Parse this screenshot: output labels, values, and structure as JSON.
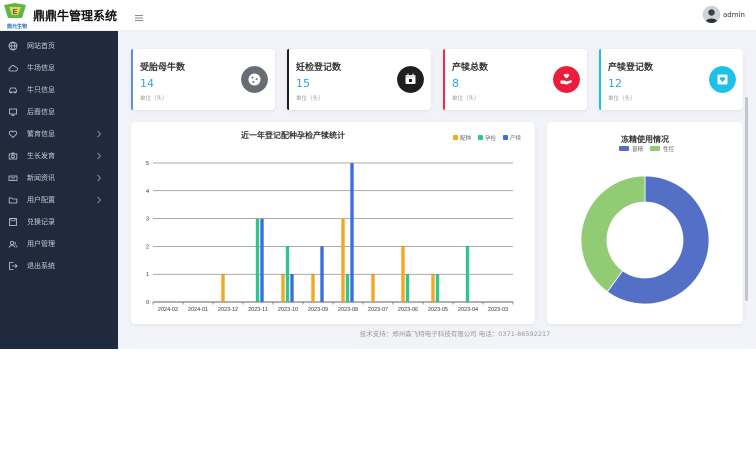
{
  "header": {
    "app_title": "鼎鼎牛管理系统",
    "logo_text": "鼎元生物",
    "username": "admin"
  },
  "sidebar": {
    "items": [
      {
        "label": "网站首页",
        "icon": "globe-icon",
        "caret": false
      },
      {
        "label": "牛场信息",
        "icon": "cloud-icon",
        "caret": false
      },
      {
        "label": "牛只信息",
        "icon": "car-icon",
        "caret": false
      },
      {
        "label": "后裔信息",
        "icon": "monitor-icon",
        "caret": false
      },
      {
        "label": "繁育信息",
        "icon": "heart-icon",
        "caret": true
      },
      {
        "label": "生长发育",
        "icon": "camera-icon",
        "caret": true
      },
      {
        "label": "新闻资讯",
        "icon": "keyboard-icon",
        "caret": true
      },
      {
        "label": "用户配置",
        "icon": "folder-icon",
        "caret": true
      },
      {
        "label": "兑换记录",
        "icon": "save-icon",
        "caret": false
      },
      {
        "label": "用户管理",
        "icon": "users-icon",
        "caret": false
      },
      {
        "label": "退出系统",
        "icon": "logout-icon",
        "caret": false
      }
    ]
  },
  "cards": [
    {
      "title": "受胎母牛数",
      "value": "14",
      "unit": "单位（头）",
      "accent": "#5b8fd6",
      "icon": "cookie-icon",
      "icon_bg": "#666d74"
    },
    {
      "title": "妊检登记数",
      "value": "15",
      "unit": "单位（头）",
      "accent": "#1f1f1f",
      "icon": "calendar-icon",
      "icon_bg": "#1f1f1f"
    },
    {
      "title": "产犊总数",
      "value": "8",
      "unit": "单位（头）",
      "accent": "#e8304a",
      "icon": "hand-heart-icon",
      "icon_bg": "#ec1c3d"
    },
    {
      "title": "产犊登记数",
      "value": "12",
      "unit": "单位（头）",
      "accent": "#1ec1e6",
      "icon": "heart-box-icon",
      "icon_bg": "#1ec1e6"
    }
  ],
  "chart_data": [
    {
      "type": "bar",
      "title": "近一年登记配种孕检产犊统计",
      "categories": [
        "2024-02",
        "2024-01",
        "2023-12",
        "2023-11",
        "2023-10",
        "2023-09",
        "2023-08",
        "2023-07",
        "2023-06",
        "2023-05",
        "2023-04",
        "2023-03"
      ],
      "series": [
        {
          "name": "配种",
          "color": "#f5a623",
          "values": [
            0,
            0,
            1,
            0,
            1,
            1,
            3,
            1,
            2,
            1,
            0,
            0
          ]
        },
        {
          "name": "孕检",
          "color": "#2fc58f",
          "values": [
            0,
            0,
            0,
            3,
            2,
            0,
            1,
            0,
            1,
            1,
            2,
            0
          ]
        },
        {
          "name": "产犊",
          "color": "#3b6ee6",
          "values": [
            0,
            0,
            0,
            3,
            1,
            2,
            5,
            0,
            0,
            0,
            0,
            0
          ]
        }
      ],
      "ylim": [
        0,
        5
      ],
      "yticks": [
        "0",
        "1",
        "2",
        "3",
        "4",
        "5"
      ],
      "grid": true,
      "legend": "top-right"
    },
    {
      "type": "pie",
      "title": "冻精使用情况",
      "series": [
        {
          "name": "普精",
          "color": "#5470c6",
          "value": 60
        },
        {
          "name": "性控",
          "color": "#91cc75",
          "value": 40
        }
      ],
      "legend": "top-center"
    }
  ],
  "footer": {
    "text": "技术支持：郑州森飞特电子科技有限公司 电话：0371-86592217"
  }
}
